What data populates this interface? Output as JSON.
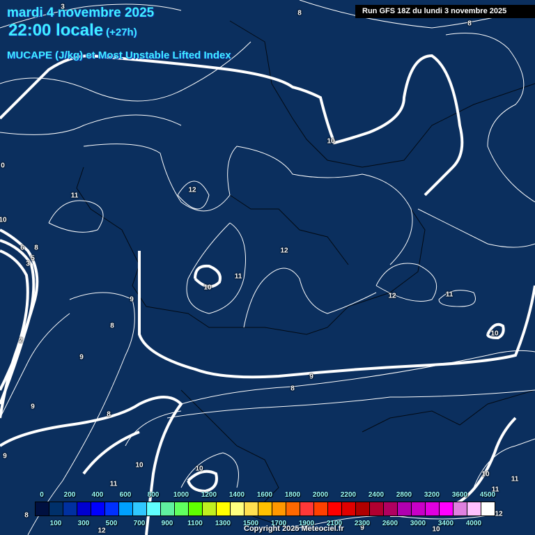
{
  "header": {
    "date": "mardi 4 novembre 2025",
    "time": "22:00 locale",
    "offset": "(+27h)",
    "product": "MUCAPE (J/kg) et Most Unstable Lifted Index",
    "run": "Run GFS 18Z du lundi 3 novembre 2025"
  },
  "contour_labels": [
    "3",
    "8",
    "8",
    "10",
    "0",
    "12",
    "11",
    "10",
    "6",
    "8",
    "5",
    "3",
    "12",
    "11",
    "10",
    "9",
    "12",
    "11",
    "8",
    "10",
    "2",
    "9",
    "9",
    "8",
    "9",
    "8",
    "9",
    "10",
    "10",
    "11",
    "10",
    "11",
    "11",
    "8",
    "12",
    "12",
    "10",
    "9"
  ],
  "colorbar": {
    "colors": [
      "#001040",
      "#00306a",
      "#0030a0",
      "#0000d0",
      "#0000ff",
      "#0030ff",
      "#00a0ff",
      "#30c8ff",
      "#60ffff",
      "#60f0a0",
      "#60ff60",
      "#60ff00",
      "#c0f020",
      "#ffff00",
      "#ffff80",
      "#ffe050",
      "#ffc000",
      "#ff9800",
      "#ff6800",
      "#ff3838",
      "#ff4000",
      "#ff0000",
      "#e00000",
      "#b00000",
      "#b00030",
      "#b00060",
      "#b000b0",
      "#c800c8",
      "#e000e0",
      "#ff00ff",
      "#e080e0",
      "#ffc0ff",
      "#ffffff"
    ],
    "labels": [
      "0",
      "100",
      "200",
      "300",
      "400",
      "500",
      "600",
      "700",
      "800",
      "900",
      "1000",
      "1100",
      "1200",
      "1300",
      "1400",
      "1500",
      "1600",
      "1700",
      "1800",
      "1900",
      "2000",
      "2100",
      "2200",
      "2300",
      "2400",
      "2600",
      "2800",
      "3000",
      "3200",
      "3400",
      "3600",
      "4000",
      "4500"
    ]
  },
  "copyright": "Copyright 2025 Meteociel.fr"
}
